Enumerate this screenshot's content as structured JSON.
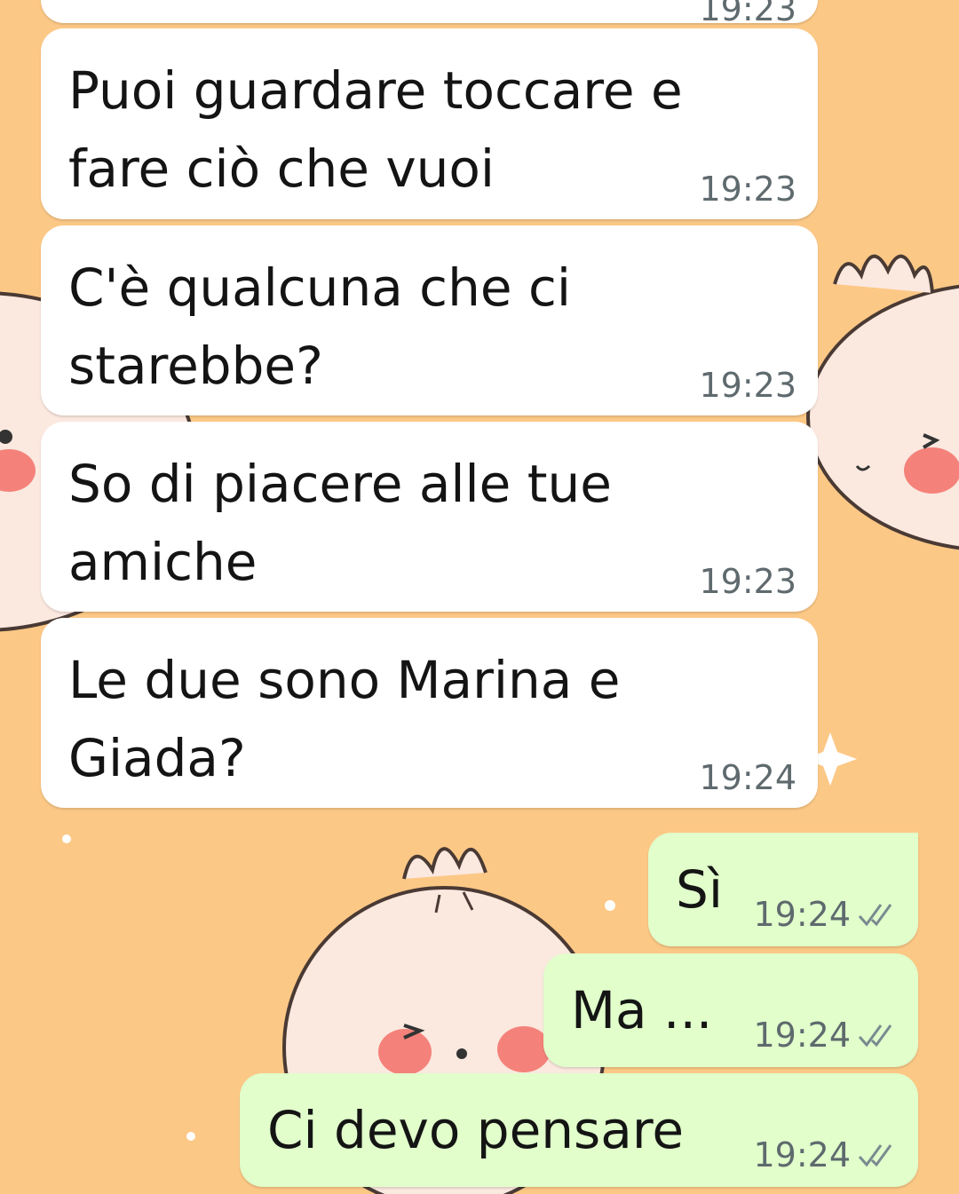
{
  "chat": {
    "top_partial_time": "19:23",
    "messages": [
      {
        "direction": "incoming",
        "text": "Puoi guardare toccare e\nfare ciò che vuoi",
        "time": "19:23"
      },
      {
        "direction": "incoming",
        "text": "C'è qualcuna che ci\nstarebbe?",
        "time": "19:23"
      },
      {
        "direction": "incoming",
        "text": "So di piacere alle tue\namiche",
        "time": "19:23"
      },
      {
        "direction": "incoming",
        "text": "Le due sono Marina e\nGiada?",
        "time": "19:24"
      },
      {
        "direction": "outgoing",
        "text": "Sì",
        "time": "19:24",
        "status_icon": "double-check-icon"
      },
      {
        "direction": "outgoing",
        "text": "Ma ...",
        "time": "19:24",
        "status_icon": "double-check-icon"
      },
      {
        "direction": "outgoing",
        "text": "Ci devo pensare",
        "time": "19:24",
        "status_icon": "double-check-icon"
      }
    ]
  },
  "theme": {
    "wallpaper_color": "#fcc886",
    "incoming_bubble": "#ffffff",
    "outgoing_bubble": "#e1fecb",
    "time_color": "#5f6a6e"
  }
}
